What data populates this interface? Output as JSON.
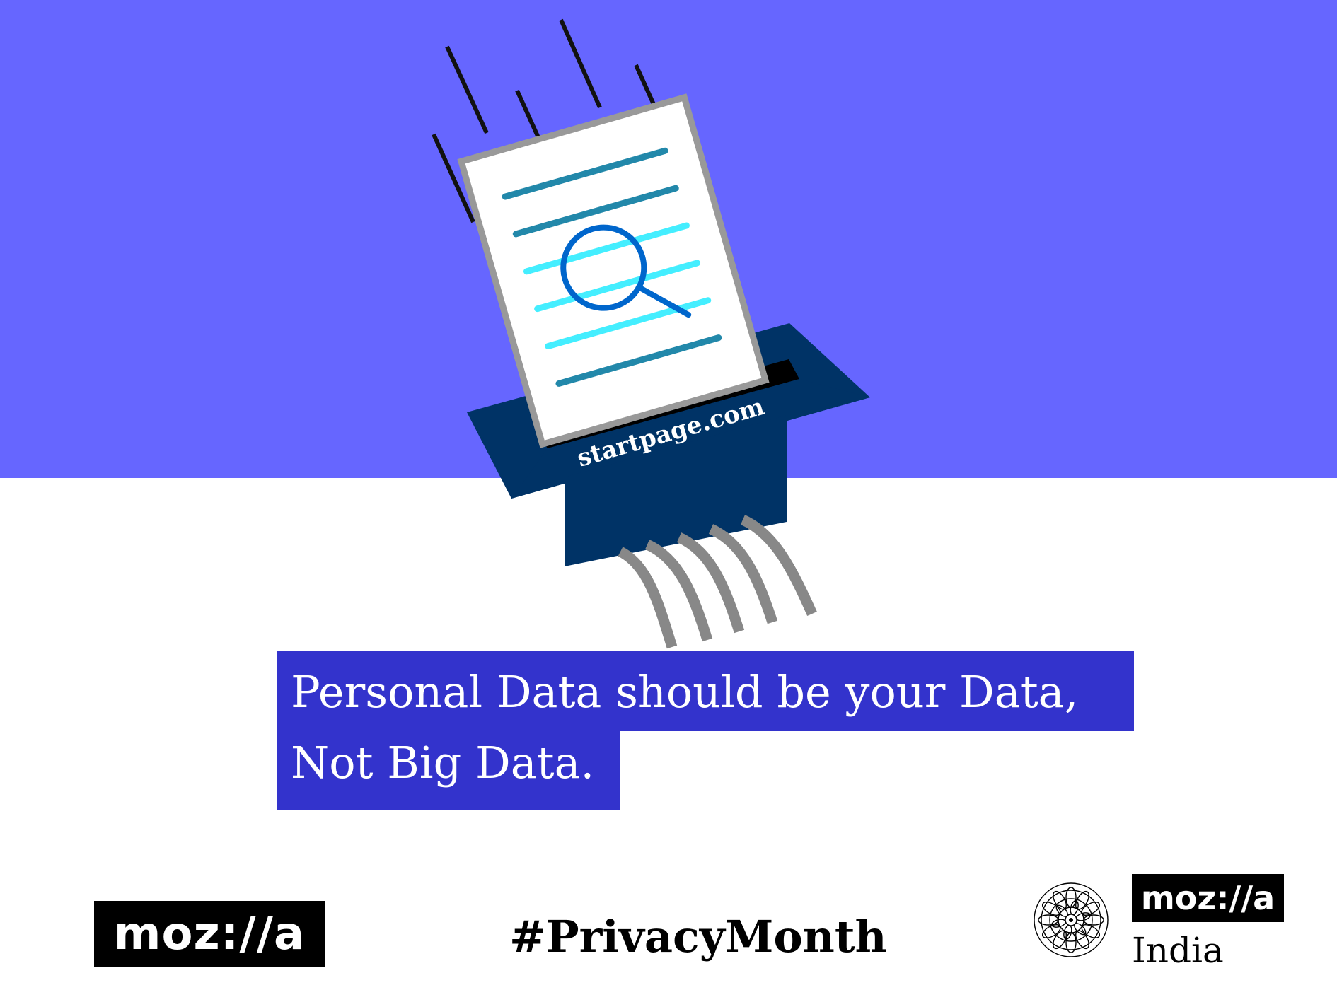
{
  "colors": {
    "top_band": "#6666ff",
    "headline_bg": "#3333cc",
    "shredder": "#003366",
    "paper_lines_dark": "#2288aa",
    "paper_lines_light": "#44eeff",
    "magnifier": "#0066cc",
    "strips": "#888888"
  },
  "illustration": {
    "shredder_label": "startpage.com",
    "icon": "magnifying-glass-icon"
  },
  "headline": {
    "line1": "Personal Data should be your Data,",
    "line2": "Not Big Data."
  },
  "footer": {
    "logo_left": "moz://a",
    "hashtag": "#PrivacyMonth",
    "logo_right": "moz://a",
    "region": "India",
    "emblem_icon": "lotus-mandala-icon"
  }
}
